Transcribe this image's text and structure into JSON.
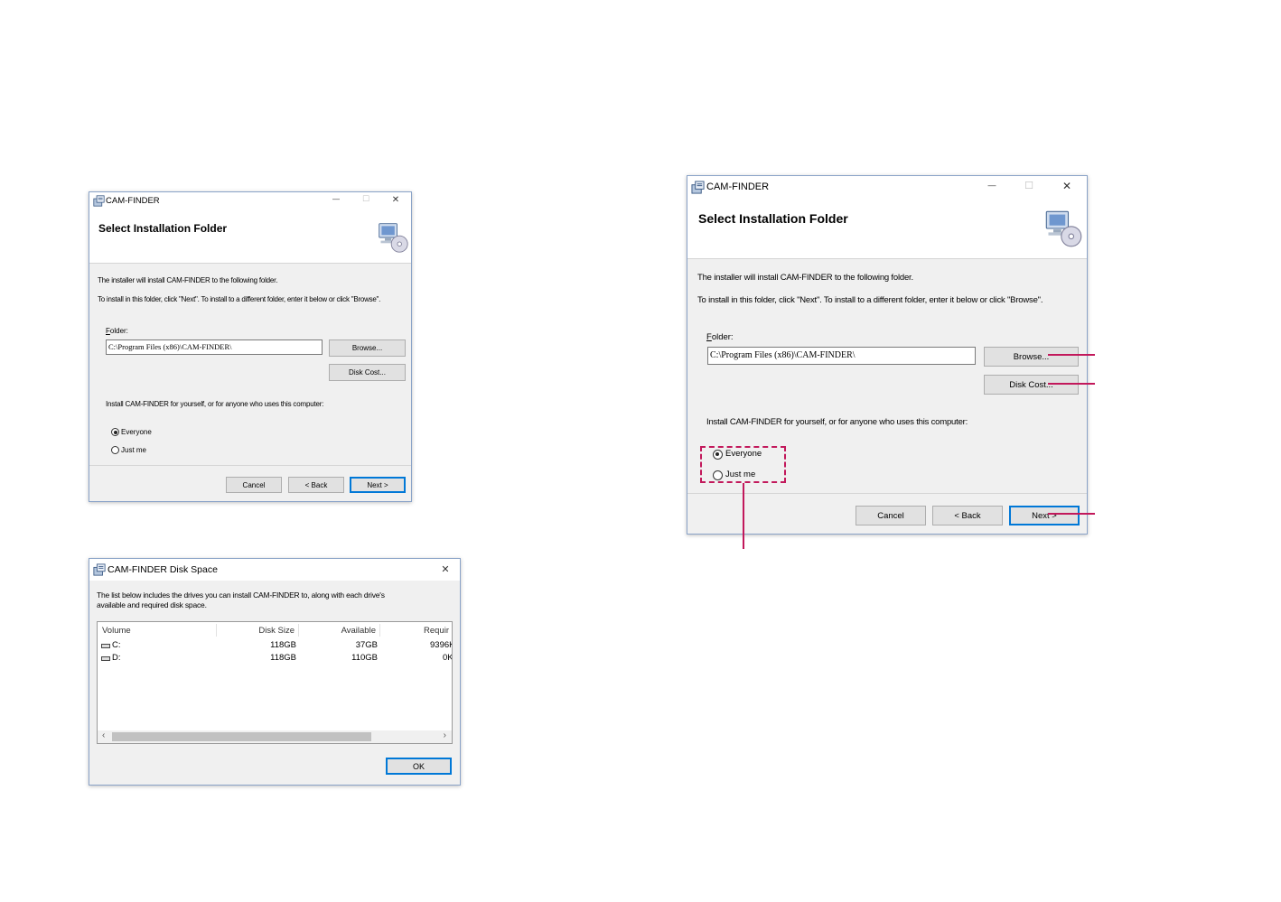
{
  "app": {
    "window_title": "CAM-FINDER",
    "title_icon": "installer-package-icon",
    "minimize_glyph": "—",
    "maximize_glyph": "☐",
    "close_glyph": "✕"
  },
  "installer": {
    "banner_title": "Select Installation Folder",
    "banner_icon": "computer-cd-icon",
    "intro_text": "The installer will install CAM-FINDER to the following folder.",
    "instructions_text": "To install in this folder, click \"Next\". To install to a different folder, enter it below or click \"Browse\".",
    "folder_label_accel": "F",
    "folder_label_rest": "older:",
    "folder_value": "C:\\Program Files (x86)\\CAM-FINDER\\",
    "browse_label": "Browse...",
    "disk_cost_label": "Disk Cost...",
    "install_for_text": "Install CAM-FINDER for yourself, or for anyone who uses this computer:",
    "option_everyone": "Everyone",
    "option_just_me": "Just me",
    "selected_option": "Everyone",
    "cancel_label": "Cancel",
    "back_label": "< Back",
    "next_label": "Next >"
  },
  "disk_space": {
    "window_title": "CAM-FINDER Disk Space",
    "description_line1": "The list below includes the drives you can install CAM-FINDER to, along with each drive's",
    "description_line2": "available and required disk space.",
    "columns": [
      "Volume",
      "Disk Size",
      "Available",
      "Requir"
    ],
    "rows": [
      {
        "volume": "C:",
        "disk_size": "118GB",
        "available": "37GB",
        "required": "9396K"
      },
      {
        "volume": "D:",
        "disk_size": "118GB",
        "available": "110GB",
        "required": "0K"
      }
    ],
    "scroll_left": "‹",
    "scroll_right": "›",
    "ok_label": "OK"
  },
  "colors": {
    "annotation": "#c2185b",
    "default_button_border": "#0078d7",
    "dialog_background": "#f0f0f0"
  }
}
